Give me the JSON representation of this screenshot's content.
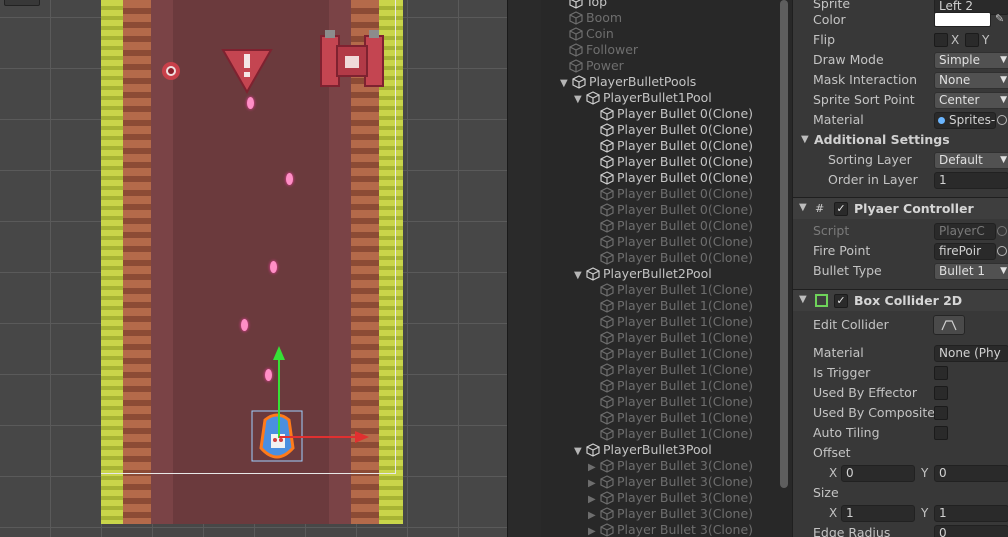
{
  "hierarchy": {
    "rows": [
      {
        "label": "Top",
        "arrow": "",
        "dim": false
      },
      {
        "label": "Boom",
        "arrow": "",
        "dim": true
      },
      {
        "label": "Coin",
        "arrow": "",
        "dim": true
      },
      {
        "label": "Follower",
        "arrow": "",
        "dim": true
      },
      {
        "label": "Power",
        "arrow": "",
        "dim": true
      },
      {
        "label": "PlayerBulletPools",
        "arrow": "▼",
        "dim": false
      },
      {
        "label": "PlayerBullet1Pool",
        "arrow": "▼",
        "dim": false
      },
      {
        "label": "Player Bullet 0(Clone)",
        "arrow": "",
        "dim": false
      },
      {
        "label": "Player Bullet 0(Clone)",
        "arrow": "",
        "dim": false
      },
      {
        "label": "Player Bullet 0(Clone)",
        "arrow": "",
        "dim": false
      },
      {
        "label": "Player Bullet 0(Clone)",
        "arrow": "",
        "dim": false
      },
      {
        "label": "Player Bullet 0(Clone)",
        "arrow": "",
        "dim": false
      },
      {
        "label": "Player Bullet 0(Clone)",
        "arrow": "",
        "dim": true
      },
      {
        "label": "Player Bullet 0(Clone)",
        "arrow": "",
        "dim": true
      },
      {
        "label": "Player Bullet 0(Clone)",
        "arrow": "",
        "dim": true
      },
      {
        "label": "Player Bullet 0(Clone)",
        "arrow": "",
        "dim": true
      },
      {
        "label": "Player Bullet 0(Clone)",
        "arrow": "",
        "dim": true
      },
      {
        "label": "PlayerBullet2Pool",
        "arrow": "▼",
        "dim": false
      },
      {
        "label": "Player Bullet 1(Clone)",
        "arrow": "",
        "dim": true
      },
      {
        "label": "Player Bullet 1(Clone)",
        "arrow": "",
        "dim": true
      },
      {
        "label": "Player Bullet 1(Clone)",
        "arrow": "",
        "dim": true
      },
      {
        "label": "Player Bullet 1(Clone)",
        "arrow": "",
        "dim": true
      },
      {
        "label": "Player Bullet 1(Clone)",
        "arrow": "",
        "dim": true
      },
      {
        "label": "Player Bullet 1(Clone)",
        "arrow": "",
        "dim": true
      },
      {
        "label": "Player Bullet 1(Clone)",
        "arrow": "",
        "dim": true
      },
      {
        "label": "Player Bullet 1(Clone)",
        "arrow": "",
        "dim": true
      },
      {
        "label": "Player Bullet 1(Clone)",
        "arrow": "",
        "dim": true
      },
      {
        "label": "Player Bullet 1(Clone)",
        "arrow": "",
        "dim": true
      },
      {
        "label": "PlayerBullet3Pool",
        "arrow": "▼",
        "dim": false
      },
      {
        "label": "Player Bullet 3(Clone)",
        "arrow": "▶",
        "dim": true
      },
      {
        "label": "Player Bullet 3(Clone)",
        "arrow": "▶",
        "dim": true
      },
      {
        "label": "Player Bullet 3(Clone)",
        "arrow": "▶",
        "dim": true
      },
      {
        "label": "Player Bullet 3(Clone)",
        "arrow": "▶",
        "dim": true
      },
      {
        "label": "Player Bullet 3(Clone)",
        "arrow": "▶",
        "dim": true
      }
    ]
  },
  "inspector": {
    "sprite_label": "Sprite",
    "sprite_value": "Left 2",
    "color_label": "Color",
    "flip_label": "Flip",
    "flip_x": "X",
    "flip_y": "Y",
    "draw_mode_label": "Draw Mode",
    "draw_mode_value": "Simple",
    "mask_label": "Mask Interaction",
    "mask_value": "None",
    "sort_point_label": "Sprite Sort Point",
    "sort_point_value": "Center",
    "material_label": "Material",
    "material_value": "Sprites-",
    "additional_title": "Additional Settings",
    "sorting_layer_label": "Sorting Layer",
    "sorting_layer_value": "Default",
    "order_label": "Order in Layer",
    "order_value": "1",
    "player_controller": {
      "title": "Plyaer Controller",
      "script_label": "Script",
      "script_value": "PlayerC",
      "fire_point_label": "Fire Point",
      "fire_point_value": "firePoir",
      "bullet_type_label": "Bullet Type",
      "bullet_type_value": "Bullet 1"
    },
    "box_collider": {
      "title": "Box Collider 2D",
      "edit_label": "Edit Collider",
      "material_label": "Material",
      "material_value": "None (Phy",
      "trigger_label": "Is Trigger",
      "effector_label": "Used By Effector",
      "composite_label": "Used By Composite",
      "tiling_label": "Auto Tiling",
      "offset_label": "Offset",
      "offset_x_label": "X",
      "offset_x": "0",
      "offset_y_label": "Y",
      "offset_y": "0",
      "size_label": "Size",
      "size_x_label": "X",
      "size_x": "1",
      "size_y_label": "Y",
      "size_y": "1",
      "edge_label": "Edge Radius",
      "edge_value": "0"
    }
  },
  "colors": {
    "editor_bg": "#383838",
    "hierarchy_bg": "#282828",
    "road": "#6b3a3d",
    "grass": "#b7c43b",
    "bullet": "#ff8fc6",
    "gizmo_y": "#36e036",
    "gizmo_x": "#e03030",
    "selection_outline": "#ff7a1a"
  }
}
